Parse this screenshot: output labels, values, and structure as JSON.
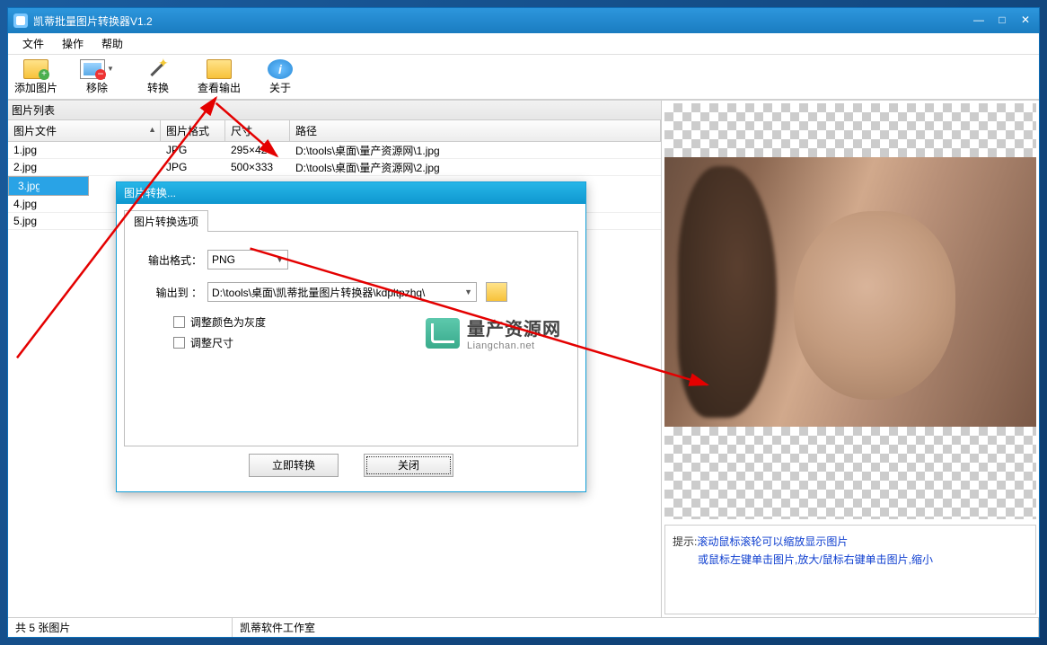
{
  "window": {
    "title": "凯蒂批量图片转换器V1.2"
  },
  "menu": {
    "file": "文件",
    "action": "操作",
    "help": "帮助"
  },
  "toolbar": {
    "add": "添加图片",
    "remove": "移除",
    "convert": "转换",
    "view_output": "查看输出",
    "about": "关于"
  },
  "list_header": "图片列表",
  "columns": {
    "file": "图片文件",
    "format": "图片格式",
    "size": "尺寸",
    "path": "路径"
  },
  "rows": [
    {
      "file": "1.jpg",
      "format": "JPG",
      "size": "295×420",
      "path": "D:\\tools\\桌面\\量产资源网\\1.jpg",
      "sel": false
    },
    {
      "file": "2.jpg",
      "format": "JPG",
      "size": "500×333",
      "path": "D:\\tools\\桌面\\量产资源网\\2.jpg",
      "sel": false
    },
    {
      "file": "3.jpg",
      "format": "",
      "size": "",
      "path": "",
      "sel": true
    },
    {
      "file": "4.jpg",
      "format": "",
      "size": "",
      "path": "",
      "sel": false
    },
    {
      "file": "5.jpg",
      "format": "",
      "size": "",
      "path": "",
      "sel": false
    }
  ],
  "dialog": {
    "title": "图片转换...",
    "tab": "图片转换选项",
    "out_format_label": "输出格式：",
    "out_format_value": "PNG",
    "out_dir_label": "输出到    ：",
    "out_dir_value": "D:\\tools\\桌面\\凯蒂批量图片转换器\\kdpltpzhq\\",
    "chk_gray": "调整颜色为灰度",
    "chk_resize": "调整尺寸",
    "btn_convert": "立即转换",
    "btn_close": "关闭"
  },
  "hint": {
    "prefix": "提示:",
    "line1": "滚动鼠标滚轮可以缩放显示图片",
    "line2": "或鼠标左键单击图片,放大/鼠标右键单击图片,缩小"
  },
  "status": {
    "count": "共 5 张图片",
    "workshop": "凯蒂软件工作室"
  },
  "watermark": {
    "cn": "量产资源网",
    "en": "Liangchan.net"
  }
}
